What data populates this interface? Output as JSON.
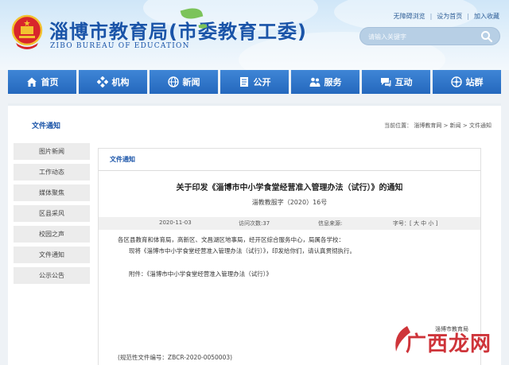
{
  "header": {
    "title": "淄博市教育局(市委教育工委)",
    "subtitle": "ZIBO BUREAU OF EDUCATION",
    "toplinks": [
      "无障碍浏览",
      "设为首页",
      "加入收藏"
    ],
    "search": {
      "placeholder": "请输入关键字"
    }
  },
  "nav": [
    {
      "label": "首页",
      "icon": "home-icon"
    },
    {
      "label": "机构",
      "icon": "org-icon"
    },
    {
      "label": "新闻",
      "icon": "globe-icon"
    },
    {
      "label": "公开",
      "icon": "document-icon"
    },
    {
      "label": "服务",
      "icon": "people-icon"
    },
    {
      "label": "互动",
      "icon": "chat-icon"
    },
    {
      "label": "站群",
      "icon": "network-icon"
    }
  ],
  "section": {
    "title": "文件通知",
    "breadcrumb": "当前位置： 淄博教育网 > 新闻 > 文件通知"
  },
  "sidebar": {
    "items": [
      "图片新闻",
      "工作动态",
      "媒体聚焦",
      "区县采风",
      "校园之声",
      "文件通知",
      "公示公告"
    ]
  },
  "article": {
    "label": "文件通知",
    "title": "关于印发《淄博市中小学食堂经营准入管理办法（试行）》的通知",
    "doc_number": "淄教教服字（2020）16号",
    "meta": {
      "date": "2020-11-03",
      "views": "访问次数:37",
      "source": "信息来源:",
      "fontsize": "字号：[ 大 中 小 ]"
    },
    "recipients": "各区县教育和体育局，高新区、文昌湖区地事局，经开区综合服务中心，局属各学校：",
    "body": "现将《淄博市中小学食堂经营准入管理办法（试行）》，印发给你们，请认真贯彻执行。",
    "attachment": "附件：《淄博市中小学食堂经营准入管理办法（试行）》",
    "publisher": "淄博市教育局",
    "std_no": "(规范性文件编号：ZBCR-2020-0050003)"
  },
  "watermark": "广西龙网",
  "colors": {
    "primary": "#1a54a8",
    "nav": "#2a6fc4",
    "watermark": "#c91f25"
  }
}
